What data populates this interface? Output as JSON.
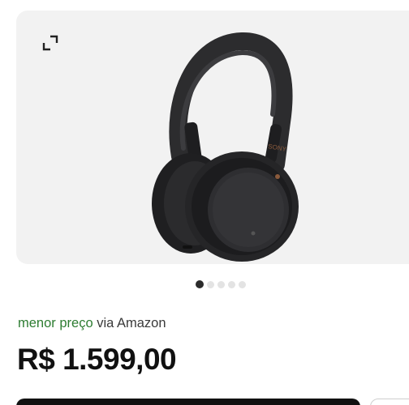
{
  "gallery": {
    "expand_icon": "expand-icon",
    "image_description_icon": "headphones-image",
    "active_index": 0,
    "total_images": 5
  },
  "offer": {
    "lowest_label": "menor preço",
    "via_text": " via Amazon",
    "price": "R$ 1.599,00"
  },
  "colors": {
    "accent_green": "#2e7d32",
    "primary_button": "#111111",
    "card_bg": "#f2f2f2"
  }
}
